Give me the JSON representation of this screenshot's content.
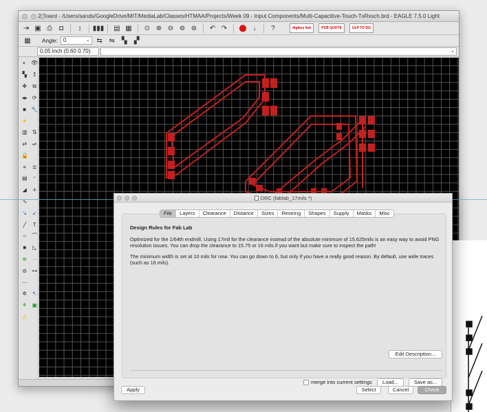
{
  "window": {
    "title": "2 Board - /Users/sands/GoogleDrive/MIT/MediaLab/Classes/HTMAA/Projects/Week 09 - Input Components/Multi-Capacitive-Touch-TxRxsch.brd - EAGLE 7.5.0 Light"
  },
  "toolbar": {
    "angle_label": "Angle:",
    "angle_value": "0",
    "coordinate": "0.05 inch (0.60 0.70)",
    "buttons": [
      {
        "name": "digikey-link-button",
        "label": "digikey link"
      },
      {
        "name": "pcb-quote-button",
        "label": "PCB QUOTE"
      },
      {
        "name": "ulp-button",
        "label": "ULP TO DO"
      }
    ]
  },
  "dialog": {
    "title": "DRC (fablab_17mils *)",
    "tabs": [
      "File",
      "Layers",
      "Clearance",
      "Distance",
      "Sizes",
      "Restring",
      "Shapes",
      "Supply",
      "Masks",
      "Misc"
    ],
    "active_tab": "File",
    "heading": "Design Rules for Fab Lab",
    "paragraph1": "Optimized for the 1/64th endmill. Using 17mil for the clearance instead of the absolute minimum of 15.625mils is an easy way to avoid PNG resolution issues. You can drop the clearance to 15.75 or 16 mils if you want but make sure to inspect the path!",
    "paragraph2": "The minimum width is set at 10 mils for now. You can go down to 6, but only if you have a really good reason. By default, use wide traces (such as 16 mils).",
    "edit_description_label": "Edit Description...",
    "merge_label": "merge into current settings",
    "load_label": "Load...",
    "save_as_label": "Save as...",
    "apply_label": "Apply",
    "select_label": "Select",
    "cancel_label": "Cancel",
    "check_label": "Check"
  },
  "colors": {
    "trace": "#c42020",
    "canvas": "#000000",
    "grid": "#555555"
  }
}
